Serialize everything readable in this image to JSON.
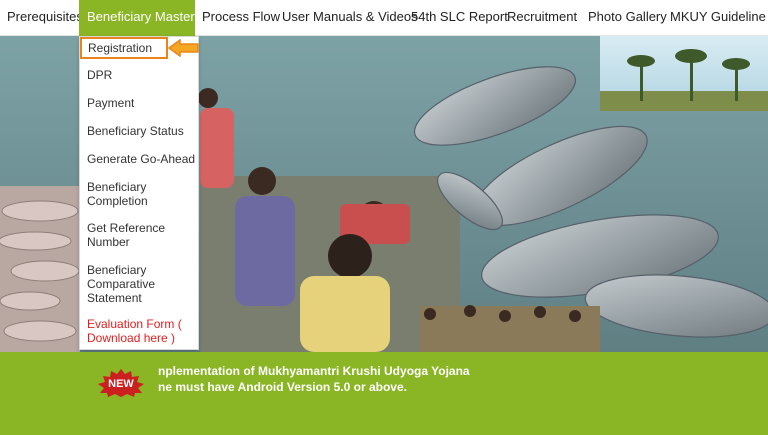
{
  "nav": {
    "items": [
      {
        "label": "Prerequisites"
      },
      {
        "label": "Beneficiary Master"
      },
      {
        "label": "Process Flow"
      },
      {
        "label": "User Manuals & Videos"
      },
      {
        "label": "54th SLC Report"
      },
      {
        "label": "Recruitment"
      },
      {
        "label": "Photo Gallery"
      },
      {
        "label": "MKUY Guideline"
      }
    ],
    "active_color": "#8ab524"
  },
  "dropdown": {
    "items": [
      {
        "label": "Registration"
      },
      {
        "label": "DPR"
      },
      {
        "label": "Payment"
      },
      {
        "label": "Beneficiary Status"
      },
      {
        "label": "Generate Go-Ahead"
      },
      {
        "label": "Beneficiary Completion"
      },
      {
        "label": "Get Reference Number"
      },
      {
        "label": "Beneficiary Comparative Statement"
      },
      {
        "label": "Evaluation Form ( Download here )"
      }
    ],
    "highlight_color": "#e8861d",
    "warning_color": "#e02020"
  },
  "footer": {
    "badge": "NEW",
    "lines": [
      "nplementation of Mukhyamantri Krushi Udyoga Yojana",
      "ne must have Android Version 5.0 or above."
    ]
  },
  "hero": {
    "description_icons": [
      "fish-icon",
      "palm-tree-icon"
    ]
  }
}
